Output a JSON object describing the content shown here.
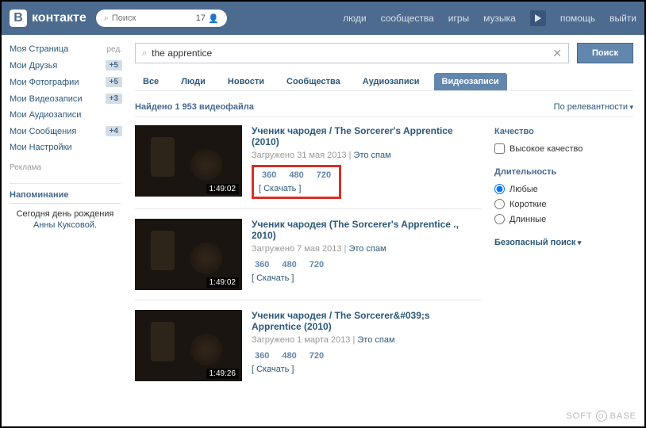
{
  "header": {
    "logo_text": "контакте",
    "logo_letter": "В",
    "search_placeholder": "Поиск",
    "notif_count": "17",
    "nav": {
      "people": "люди",
      "communities": "сообщества",
      "games": "игры",
      "music": "музыка",
      "help": "помощь",
      "logout": "выйти"
    }
  },
  "sidebar": {
    "items": [
      {
        "label": "Моя Страница",
        "extra": "ред."
      },
      {
        "label": "Мои Друзья",
        "extra": "+5"
      },
      {
        "label": "Мои Фотографии",
        "extra": "+5"
      },
      {
        "label": "Мои Видеозаписи",
        "extra": "+3"
      },
      {
        "label": "Мои Аудиозаписи",
        "extra": ""
      },
      {
        "label": "Мои Сообщения",
        "extra": "+4"
      },
      {
        "label": "Мои Настройки",
        "extra": ""
      }
    ],
    "ad_label": "Реклама",
    "reminder": {
      "title": "Напоминание",
      "text_pre": "Сегодня ",
      "text_mid": "день рождения ",
      "link": "Анны Куксовой",
      "after": "."
    }
  },
  "search": {
    "value": "the apprentice",
    "button": "Поиск"
  },
  "tabs": [
    "Все",
    "Люди",
    "Новости",
    "Сообщества",
    "Аудиозаписи",
    "Видеозаписи"
  ],
  "active_tab": 5,
  "results": {
    "count_label": "Найдено 1 953 видеофайла",
    "sort": "По релевантности",
    "videos": [
      {
        "title": "Ученик чародея / The Sorcerer's Apprentice (2010)",
        "uploaded": "Загружено 31 мая 2013",
        "spam": "Это спам",
        "qualities": [
          "360",
          "480",
          "720"
        ],
        "download": "[ Скачать ]",
        "duration": "1:49:02",
        "highlighted": true
      },
      {
        "title": "Ученик чародея (The Sorcerer's Apprentice ., 2010)",
        "uploaded": "Загружено 7 мая 2013",
        "spam": "Это спам",
        "qualities": [
          "360",
          "480",
          "720"
        ],
        "download": "[ Скачать ]",
        "duration": "1:49:02",
        "highlighted": false
      },
      {
        "title": "Ученик чародея / The Sorcerer&#039;s Apprentice (2010)",
        "uploaded": "Загружено 1 марта 2013",
        "spam": "Это спам",
        "qualities": [
          "360",
          "480",
          "720"
        ],
        "download": "[ Скачать ]",
        "duration": "1:49:26",
        "highlighted": false
      }
    ]
  },
  "filters": {
    "quality_title": "Качество",
    "quality_hd": "Высокое качество",
    "duration_title": "Длительность",
    "duration_options": [
      "Любые",
      "Короткие",
      "Длинные"
    ],
    "duration_selected": 0,
    "safe_search": "Безопасный поиск"
  },
  "watermark": {
    "text1": "SOFT",
    "circle": "O",
    "text2": "BASE"
  }
}
